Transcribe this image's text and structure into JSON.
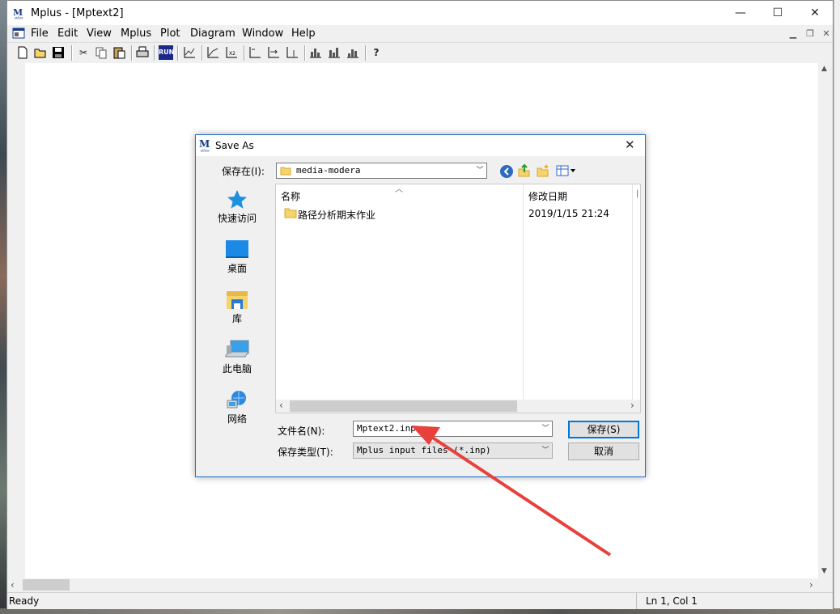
{
  "window": {
    "title": "Mplus - [Mptext2]",
    "controls": {
      "minimize": "—",
      "maximize": "☐",
      "close": "✕"
    }
  },
  "menu": [
    "File",
    "Edit",
    "View",
    "Mplus",
    "Plot",
    "Diagram",
    "Window",
    "Help"
  ],
  "toolbar": {
    "run_label": "RUN",
    "help_label": "?"
  },
  "status": {
    "left": "Ready",
    "right": "Ln 1, Col 1"
  },
  "dialog": {
    "title": "Save As",
    "save_in_label": "保存在(I):",
    "save_in_value": "media-modera",
    "places": [
      {
        "label": "快速访问",
        "icon": "star-icon"
      },
      {
        "label": "桌面",
        "icon": "desktop-icon"
      },
      {
        "label": "库",
        "icon": "library-icon"
      },
      {
        "label": "此电脑",
        "icon": "computer-icon"
      },
      {
        "label": "网络",
        "icon": "network-icon"
      }
    ],
    "columns": {
      "name": "名称",
      "modified": "修改日期"
    },
    "files": [
      {
        "name": "路径分析期末作业",
        "modified": "2019/1/15 21:24"
      }
    ],
    "filename_label": "文件名(N):",
    "filename_value": "Mptext2.inp",
    "filetype_label": "保存类型(T):",
    "filetype_value": "Mplus input files (*.inp)",
    "save_button": "保存(S)",
    "cancel_button": "取消"
  },
  "colors": {
    "annotation_arrow": "#e8413c",
    "accent": "#0078d7",
    "folder": "#f6d36b"
  }
}
